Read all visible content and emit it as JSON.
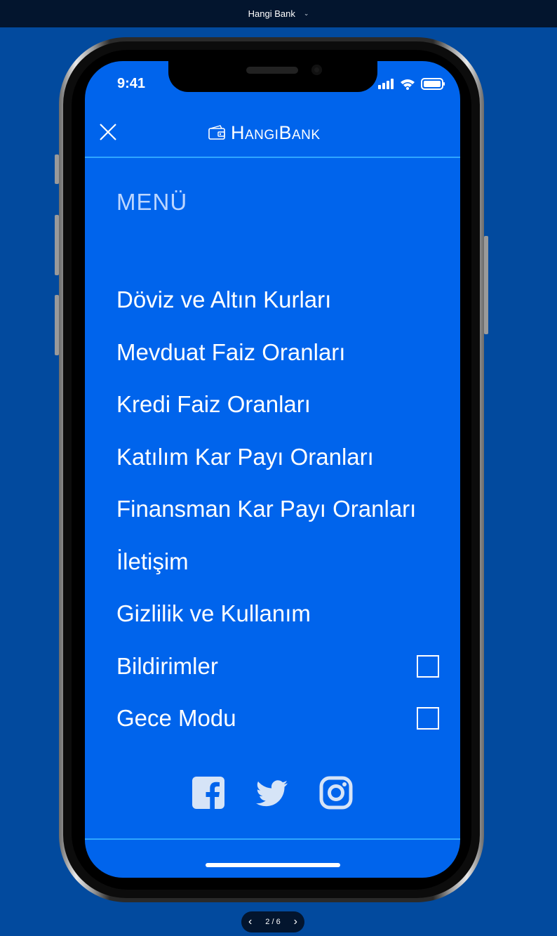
{
  "viewer": {
    "title": "Hangi Bank",
    "pager": "2 / 6"
  },
  "status_bar": {
    "time": "9:41"
  },
  "header": {
    "logo_text": "HangiBank"
  },
  "menu": {
    "title": "MENÜ",
    "items": [
      {
        "label": "Döviz ve Altın Kurları"
      },
      {
        "label": "Mevduat Faiz Oranları"
      },
      {
        "label": "Kredi Faiz Oranları"
      },
      {
        "label": "Katılım Kar Payı Oranları"
      },
      {
        "label": "Finansman Kar Payı Oranları"
      },
      {
        "label": "İletişim"
      },
      {
        "label": "Gizlilik ve Kullanım"
      },
      {
        "label": "Bildirimler",
        "toggle": false
      },
      {
        "label": "Gece Modu",
        "toggle": false
      }
    ]
  },
  "social": [
    "facebook-icon",
    "twitter-icon",
    "instagram-icon"
  ],
  "colors": {
    "background": "#024a9e",
    "screen": "#0064ec",
    "divider": "#2fa6ff",
    "menu_title": "#bcd6ff"
  }
}
